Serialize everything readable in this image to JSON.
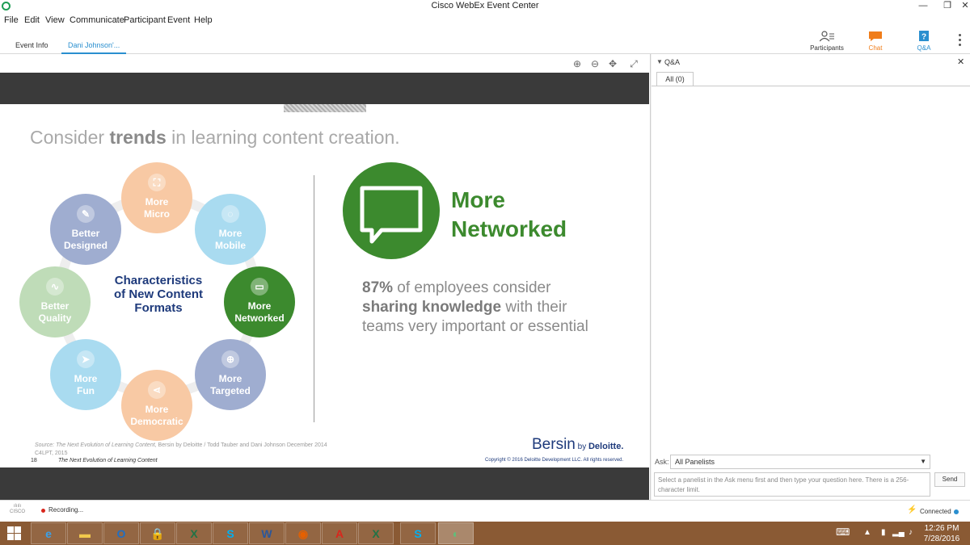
{
  "window": {
    "title": "Cisco WebEx Event Center",
    "minimize": "—",
    "restore": "❐",
    "close": "✕"
  },
  "menu": [
    "File",
    "Edit",
    "View",
    "Communicate",
    "Participant",
    "Event",
    "Help"
  ],
  "tabs": [
    {
      "label": "Event Info",
      "active": false
    },
    {
      "label": "Dani Johnson'...",
      "active": true
    }
  ],
  "panel_buttons": [
    {
      "label": "Participants",
      "icon": "participants-icon",
      "color": "#333333"
    },
    {
      "label": "Chat",
      "icon": "chat-icon",
      "color": "#f07d1a"
    },
    {
      "label": "Q&A",
      "icon": "qa-icon",
      "color": "#2a8fcf"
    }
  ],
  "slide": {
    "title_pre": "Consider ",
    "title_bold": "trends",
    "title_post": " in learning content creation.",
    "center_label": [
      "Characteristics",
      "of New Content",
      "Formats"
    ],
    "circles": [
      {
        "l1": "More",
        "l2": "Micro",
        "color": "#f8c9a4",
        "icon": "crop-icon",
        "glyph": "⛶"
      },
      {
        "l1": "More",
        "l2": "Mobile",
        "color": "#a9dbf0",
        "icon": "wifi-icon",
        "glyph": "◌"
      },
      {
        "l1": "More",
        "l2": "Networked",
        "color": "#3c8a2e",
        "icon": "speech-bubble-icon",
        "glyph": "▭"
      },
      {
        "l1": "More",
        "l2": "Targeted",
        "color": "#9fadd0",
        "icon": "target-icon",
        "glyph": "⊕"
      },
      {
        "l1": "More",
        "l2": "Democratic",
        "color": "#f8c9a4",
        "icon": "share-icon",
        "glyph": "⋖"
      },
      {
        "l1": "More",
        "l2": "Fun",
        "color": "#a9dbf0",
        "icon": "paper-plane-icon",
        "glyph": "➤"
      },
      {
        "l1": "Better",
        "l2": "Quality",
        "color": "#bfdcb8",
        "icon": "chart-icon",
        "glyph": "∿"
      },
      {
        "l1": "Better",
        "l2": "Designed",
        "color": "#9fadd0",
        "icon": "pen-icon",
        "glyph": "✎"
      }
    ],
    "feature_title_1": "More",
    "feature_title_2": "Networked",
    "stat_pct": "87%",
    "stat_1": " of employees consider",
    "stat_bold": "sharing knowledge",
    "stat_2": " with their",
    "stat_3": "teams very important or essential",
    "source_label": "Source: ",
    "source_title": "The Next Evolution of Learning Content",
    "source_rest": ", Bersin by Deloitte / Todd Tauber and Dani Johnson December 2014",
    "source_line2": "C4LPT, 2015",
    "slide_number": "18",
    "footer": "The Next Evolution of Learning Content",
    "brand": "Bersin",
    "brand_by": " by ",
    "brand_deloitte": "Deloitte.",
    "copyright": "Copyright © 2016 Deloitte Development LLC. All rights reserved."
  },
  "qa": {
    "title": "Q&A",
    "tab_all": "All (0)",
    "ask_label": "Ask:",
    "ask_value": "All Panelists",
    "input_placeholder": "Select a panelist in the Ask menu first and then type your question here. There is a 256-character limit.",
    "send": "Send"
  },
  "status": {
    "cisco": "CISCO",
    "recording": "Recording...",
    "connected": "Connected"
  },
  "taskbar": {
    "apps": [
      {
        "name": "ie",
        "glyph": "e",
        "color": "#3aa0e8"
      },
      {
        "name": "explorer",
        "glyph": "▬",
        "color": "#f2c94c"
      },
      {
        "name": "outlook",
        "glyph": "O",
        "color": "#1f6fc4"
      },
      {
        "name": "keepass",
        "glyph": "🔒",
        "color": "#d8b24a"
      },
      {
        "name": "excel",
        "glyph": "X",
        "color": "#217346"
      },
      {
        "name": "skype",
        "glyph": "S",
        "color": "#00aff0"
      },
      {
        "name": "word",
        "glyph": "W",
        "color": "#2b579a"
      },
      {
        "name": "firefox",
        "glyph": "◉",
        "color": "#e66000"
      },
      {
        "name": "acrobat",
        "glyph": "A",
        "color": "#d9261c"
      },
      {
        "name": "excel2",
        "glyph": "X",
        "color": "#217346"
      },
      {
        "name": "skype2",
        "glyph": "S",
        "color": "#00aff0"
      },
      {
        "name": "webex",
        "glyph": "◐",
        "color": "#5fbf7a"
      }
    ],
    "time": "12:26 PM",
    "date": "7/28/2016"
  }
}
